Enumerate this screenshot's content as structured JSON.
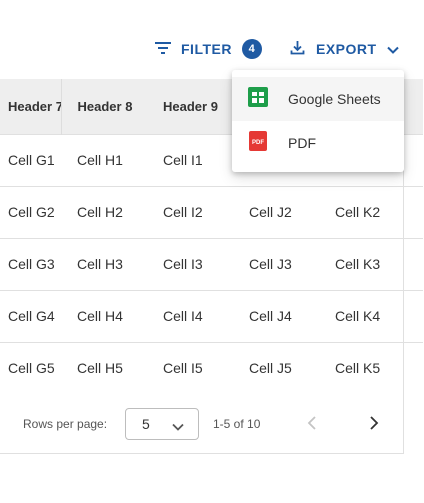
{
  "toolbar": {
    "filter_label": "FILTER",
    "filter_count": "4",
    "export_label": "EXPORT",
    "accent_color": "#1f5aa3",
    "filter_icon": "filter-icon",
    "export_icon": "download-icon",
    "export_chevron_icon": "chevron-down-icon"
  },
  "table": {
    "headers": [
      "Header 7",
      "Header 8",
      "Header 9",
      "",
      ""
    ],
    "rows": [
      [
        "Cell G1",
        "Cell H1",
        "Cell I1",
        "",
        ""
      ],
      [
        "Cell G2",
        "Cell H2",
        "Cell I2",
        "Cell J2",
        "Cell K2"
      ],
      [
        "Cell G3",
        "Cell H3",
        "Cell I3",
        "Cell J3",
        "Cell K3"
      ],
      [
        "Cell G4",
        "Cell H4",
        "Cell I4",
        "Cell J4",
        "Cell K4"
      ],
      [
        "Cell G5",
        "Cell H5",
        "Cell I5",
        "Cell J5",
        "Cell K5"
      ]
    ]
  },
  "pagination": {
    "rows_per_page_label": "Rows per page:",
    "rows_per_page_value": "5",
    "range_text": "1-5 of 10",
    "prev_icon": "chevron-left-icon",
    "next_icon": "chevron-right-icon"
  },
  "export_menu": {
    "items": [
      {
        "label": "Google Sheets",
        "icon": "google-sheets-icon",
        "color": "#1e9e4a"
      },
      {
        "label": "PDF",
        "icon": "pdf-icon",
        "color": "#e53935"
      }
    ]
  }
}
